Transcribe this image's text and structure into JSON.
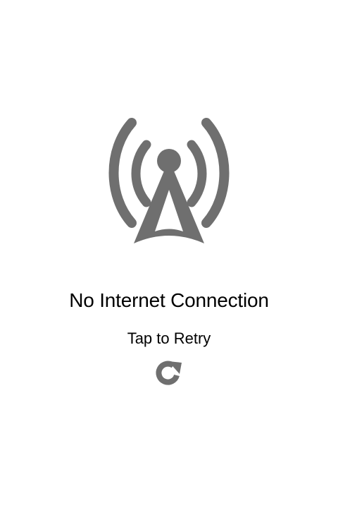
{
  "screen": {
    "background": "#ffffff",
    "icon": "signal-tower-icon",
    "icon_color": "#6f6f6f"
  },
  "message": {
    "title": "No Internet Connection",
    "retry_label": "Tap to Retry",
    "retry_icon": "refresh-icon"
  }
}
